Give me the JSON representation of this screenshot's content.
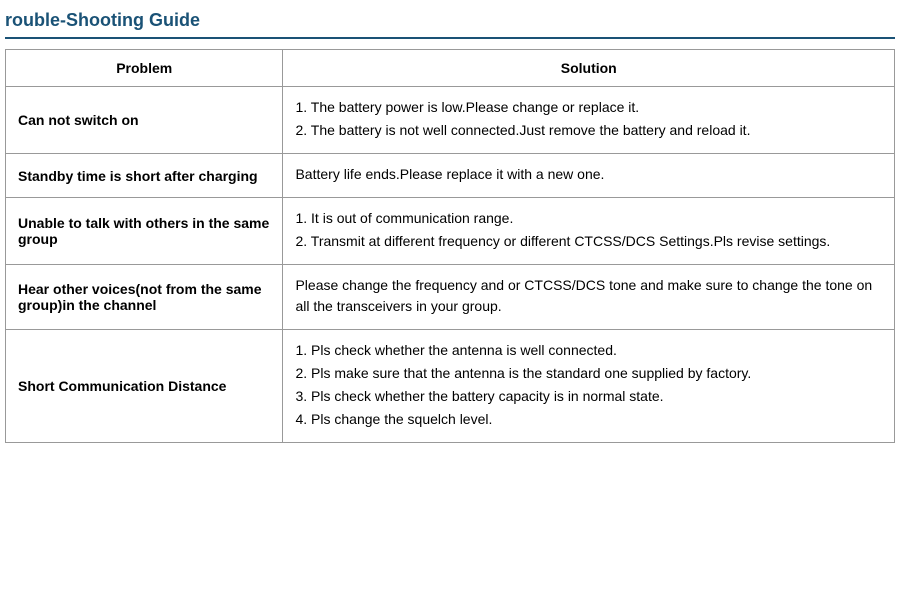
{
  "title": "rouble-Shooting Guide",
  "table": {
    "headers": [
      "Problem",
      "Solution"
    ],
    "rows": [
      {
        "problem": "Can not switch on",
        "solution_lines": [
          "1. The battery power is low.Please change or replace it.",
          "2. The battery is not well connected.Just remove the battery and reload it."
        ]
      },
      {
        "problem": "Standby time is short after charging",
        "solution_lines": [
          "Battery life ends.Please replace it with a new one."
        ]
      },
      {
        "problem": "Unable to talk with others in the same group",
        "solution_lines": [
          "1. It is out of communication range.",
          "2.  Transmit at different frequency or different CTCSS/DCS Settings.Pls revise settings."
        ]
      },
      {
        "problem": "Hear other voices(not from the same group)in the channel",
        "solution_lines": [
          "Please change the frequency and or CTCSS/DCS tone and make sure to change the tone on all the transceivers in your group."
        ]
      },
      {
        "problem": "Short Communication Distance",
        "solution_lines": [
          "1. Pls check whether the antenna is well connected.",
          "2. Pls make sure that the antenna is the standard one supplied by factory.",
          "3. Pls check whether the battery capacity is in normal state.",
          "4. Pls change the squelch level."
        ]
      }
    ]
  }
}
